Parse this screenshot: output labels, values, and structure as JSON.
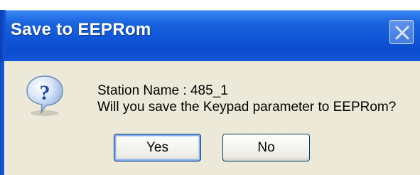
{
  "dialog": {
    "title": "Save to EEPRom",
    "icon": "question-icon",
    "message_line1": "Station Name : 485_1",
    "message_line2": "Will you save the Keypad parameter to EEPRom?",
    "yes_label": "Yes",
    "no_label": "No"
  },
  "colors": {
    "titlebar": "#0b4ccc",
    "dialog_background": "#ece9d8",
    "button_border": "#003c74"
  }
}
